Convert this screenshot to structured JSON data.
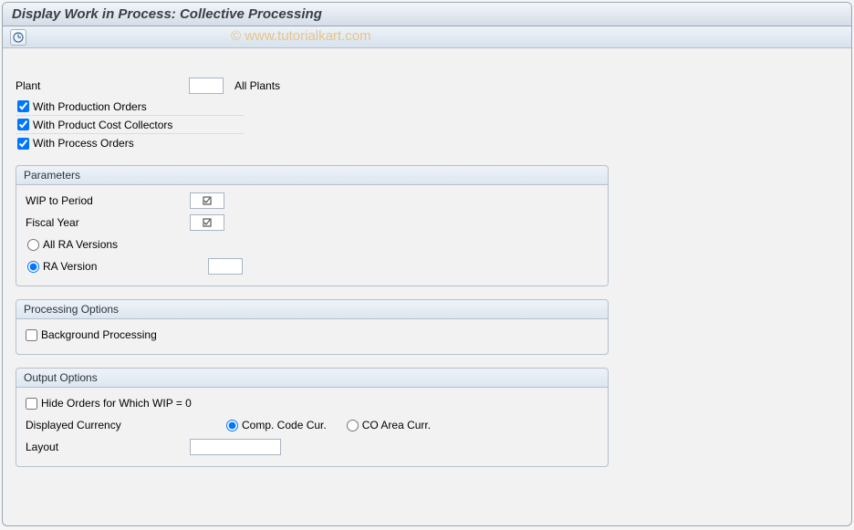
{
  "window": {
    "title": "Display Work in Process: Collective Processing"
  },
  "watermark": "© www.tutorialkart.com",
  "toolbar": {
    "execute_icon": "execute"
  },
  "top": {
    "plant_label": "Plant",
    "plant_value": "",
    "all_plants_label": "All Plants",
    "with_prod_orders": {
      "label": "With Production Orders",
      "checked": true
    },
    "with_cost_collectors": {
      "label": "With Product Cost Collectors",
      "checked": true
    },
    "with_process_orders": {
      "label": "With Process Orders",
      "checked": true
    }
  },
  "parameters": {
    "title": "Parameters",
    "wip_period_label": "WIP to Period",
    "wip_period_value": "",
    "fiscal_year_label": "Fiscal Year",
    "fiscal_year_value": "",
    "all_ra_label": "All RA Versions",
    "ra_version_label": "RA Version",
    "ra_version_value": "",
    "ra_selected": "ra_version"
  },
  "processing": {
    "title": "Processing Options",
    "background": {
      "label": "Background Processing",
      "checked": false
    }
  },
  "output": {
    "title": "Output Options",
    "hide_orders": {
      "label": "Hide Orders for Which WIP = 0",
      "checked": false
    },
    "currency_label": "Displayed Currency",
    "currency_comp": "Comp. Code Cur.",
    "currency_co": "CO Area Curr.",
    "currency_selected": "comp",
    "layout_label": "Layout",
    "layout_value": ""
  }
}
